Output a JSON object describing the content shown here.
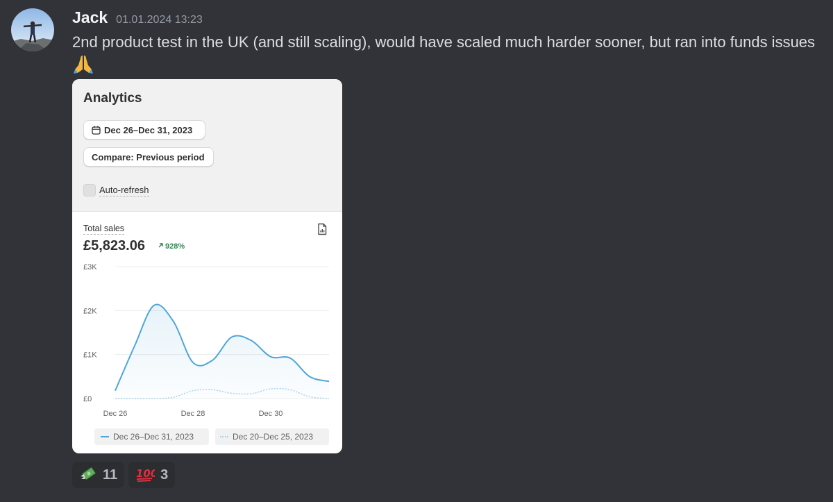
{
  "message": {
    "author": "Jack",
    "timestamp": "01.01.2024 13:23",
    "text": "2nd product test in the UK (and still scaling), would have scaled much harder sooner, but ran into funds issues",
    "emoji": "folded-hands"
  },
  "card": {
    "title": "Analytics",
    "date_range": "Dec 26–Dec 31, 2023",
    "compare": "Compare: Previous period",
    "auto_refresh": "Auto-refresh",
    "metric_label": "Total sales",
    "metric_value": "£5,823.06",
    "metric_change": "928%",
    "legend_current": "Dec 26–Dec 31, 2023",
    "legend_previous": "Dec 20–Dec 25, 2023"
  },
  "chart_data": {
    "type": "line",
    "title": "",
    "xlabel": "",
    "ylabel": "",
    "y_ticks": [
      "£0",
      "£1K",
      "£2K",
      "£3K"
    ],
    "x_ticks": [
      "Dec 26",
      "Dec 28",
      "Dec 30"
    ],
    "ylim": [
      0,
      3000
    ],
    "x": [
      0,
      0.5,
      1,
      1.5,
      2,
      2.5,
      3,
      3.5,
      4,
      4.5,
      5,
      5.5
    ],
    "series": [
      {
        "name": "Dec 26–Dec 31, 2023",
        "color": "#4fa6d6",
        "style": "solid",
        "values": [
          180,
          1200,
          2120,
          1750,
          820,
          870,
          1400,
          1320,
          950,
          920,
          500,
          390
        ]
      },
      {
        "name": "Dec 20–Dec 25, 2023",
        "color": "#a9d3ea",
        "style": "dotted",
        "values": [
          0,
          0,
          0,
          30,
          180,
          200,
          120,
          110,
          220,
          200,
          40,
          0
        ]
      }
    ]
  },
  "reactions": [
    {
      "emoji": "money-with-wings",
      "count": "11"
    },
    {
      "emoji": "hundred-points",
      "count": "3"
    }
  ]
}
